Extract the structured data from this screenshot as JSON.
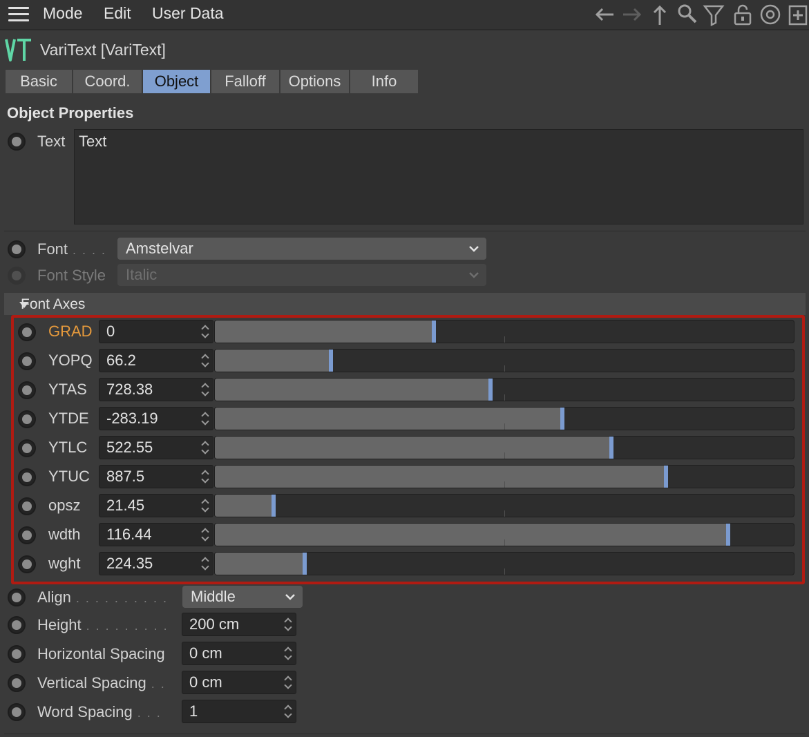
{
  "menubar": {
    "items": [
      "Mode",
      "Edit",
      "User Data"
    ]
  },
  "toolbar": {
    "icons": [
      "arrow-left-icon",
      "arrow-right-icon",
      "arrow-up-icon",
      "search-icon",
      "filter-icon",
      "lock-icon",
      "target-icon",
      "new-window-icon"
    ]
  },
  "object": {
    "logo": "VT",
    "title": "VariText [VariText]"
  },
  "tabs": [
    {
      "label": "Basic",
      "active": false
    },
    {
      "label": "Coord.",
      "active": false
    },
    {
      "label": "Object",
      "active": true
    },
    {
      "label": "Falloff",
      "active": false
    },
    {
      "label": "Options",
      "active": false
    },
    {
      "label": "Info",
      "active": false
    }
  ],
  "section": {
    "title": "Object Properties"
  },
  "text_field": {
    "label": "Text",
    "value": "Text"
  },
  "font": {
    "label": "Font",
    "value": "Amstelvar"
  },
  "font_style": {
    "label": "Font Style",
    "value": "Italic"
  },
  "font_axes": {
    "title": "Font Axes",
    "axes": [
      {
        "name": "GRAD",
        "value": "0",
        "fraction": 0.375,
        "highlight": true
      },
      {
        "name": "YOPQ",
        "value": "66.2",
        "fraction": 0.197
      },
      {
        "name": "YTAS",
        "value": "728.38",
        "fraction": 0.472
      },
      {
        "name": "YTDE",
        "value": "-283.19",
        "fraction": 0.597
      },
      {
        "name": "YTLC",
        "value": "522.55",
        "fraction": 0.681
      },
      {
        "name": "YTUC",
        "value": "887.5",
        "fraction": 0.776
      },
      {
        "name": "opsz",
        "value": "21.45",
        "fraction": 0.098
      },
      {
        "name": "wdth",
        "value": "116.44",
        "fraction": 0.883
      },
      {
        "name": "wght",
        "value": "224.35",
        "fraction": 0.152
      }
    ]
  },
  "align": {
    "label": "Align",
    "value": "Middle"
  },
  "height": {
    "label": "Height",
    "value": "200 cm"
  },
  "h_spacing": {
    "label": "Horizontal Spacing",
    "value": "0 cm"
  },
  "v_spacing": {
    "label": "Vertical Spacing",
    "value": "0 cm"
  },
  "word_spacing": {
    "label": "Word Spacing",
    "value": "1"
  },
  "colors": {
    "accent": "#7f9fd0",
    "highlight": "#e69a3c",
    "frame": "#b01b12",
    "logo": "#5fd6a6"
  }
}
